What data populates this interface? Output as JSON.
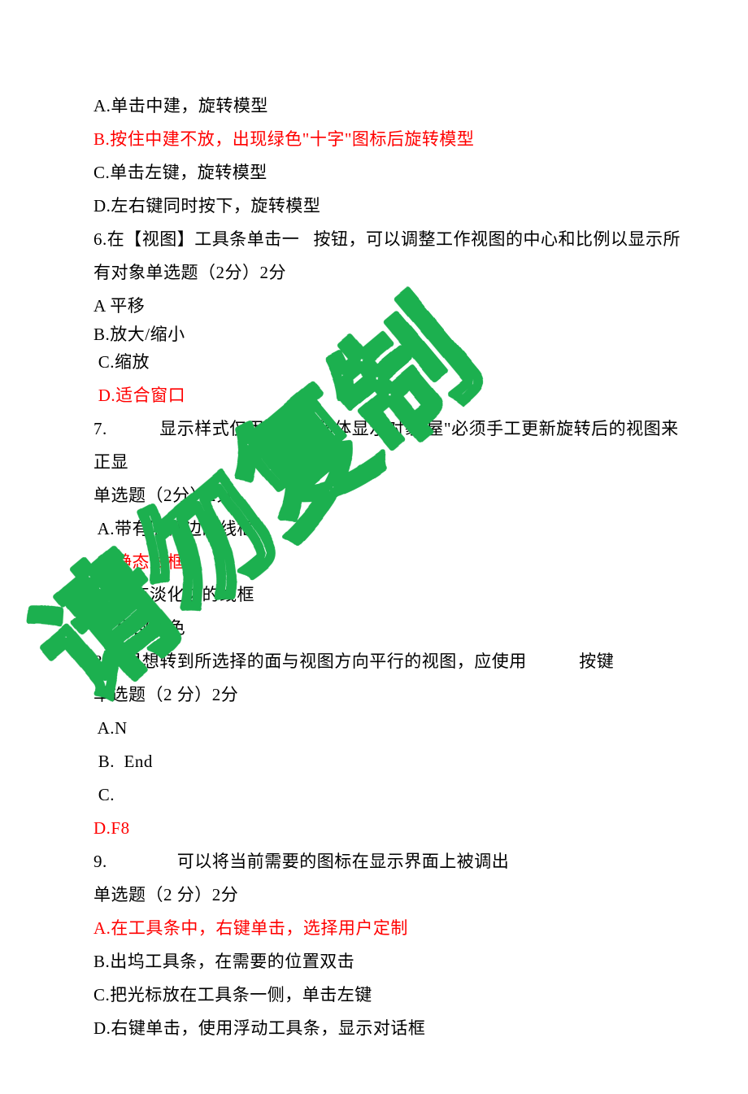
{
  "lines": [
    {
      "text": "A.单击中建，旋转模型",
      "cls": ""
    },
    {
      "text": "B.按住中建不放，出现绿色\"十字\"图标后旋转模型",
      "cls": "red"
    },
    {
      "text": "C.单击左键，旋转模型",
      "cls": ""
    },
    {
      "text": "D.左右键同时按下，旋转模型",
      "cls": ""
    },
    {
      "text": "6.在【视图】工具条单击一   按钮，可以调整工作视图的中心和比例以显示所",
      "cls": ""
    },
    {
      "text": "有对象单选题（2分）2分",
      "cls": ""
    },
    {
      "text": "A 平移",
      "cls": ""
    },
    {
      "text": "B.放大/缩小",
      "cls": "tight"
    },
    {
      "text": " C.缩放",
      "cls": ""
    },
    {
      "text": " D.适合窗口",
      "cls": "red"
    },
    {
      "text": "7.　　　显示样式仅用边缘几何体显示对象,屋\"必须手工更新旋转后的视图来",
      "cls": ""
    },
    {
      "text": "正显",
      "cls": ""
    },
    {
      "text": "单选题（2分）2分",
      "cls": ""
    },
    {
      "text": " A.带有隐藏边的线框",
      "cls": ""
    },
    {
      "text": " B.静态线框",
      "cls": "red"
    },
    {
      "text": " C.带有淡化边的线框",
      "cls": ""
    },
    {
      "text": " D.局部着色",
      "cls": ""
    },
    {
      "text": "8.如果想转到所选择的面与视图方向平行的视图，应使用　　　按键",
      "cls": ""
    },
    {
      "text": "单选题（2 分）2分",
      "cls": ""
    },
    {
      "text": " A.N",
      "cls": ""
    },
    {
      "text": " B.  End",
      "cls": ""
    },
    {
      "text": " C.",
      "cls": ""
    },
    {
      "text": "D.F8",
      "cls": "red"
    },
    {
      "text": "9.　　　　可以将当前需要的图标在显示界面上被调出",
      "cls": ""
    },
    {
      "text": "单选题（2 分）2分",
      "cls": ""
    },
    {
      "text": "A.在工具条中，右键单击，选择用户定制",
      "cls": "red"
    },
    {
      "text": "B.出坞工具条，在需要的位置双击",
      "cls": ""
    },
    {
      "text": "C.把光标放在工具条一侧，单击左键",
      "cls": ""
    },
    {
      "text": "D.右键单击，使用浮动工具条，显示对话框",
      "cls": ""
    }
  ],
  "watermark": {
    "text": "请勿复制",
    "color": "#1eb050"
  }
}
